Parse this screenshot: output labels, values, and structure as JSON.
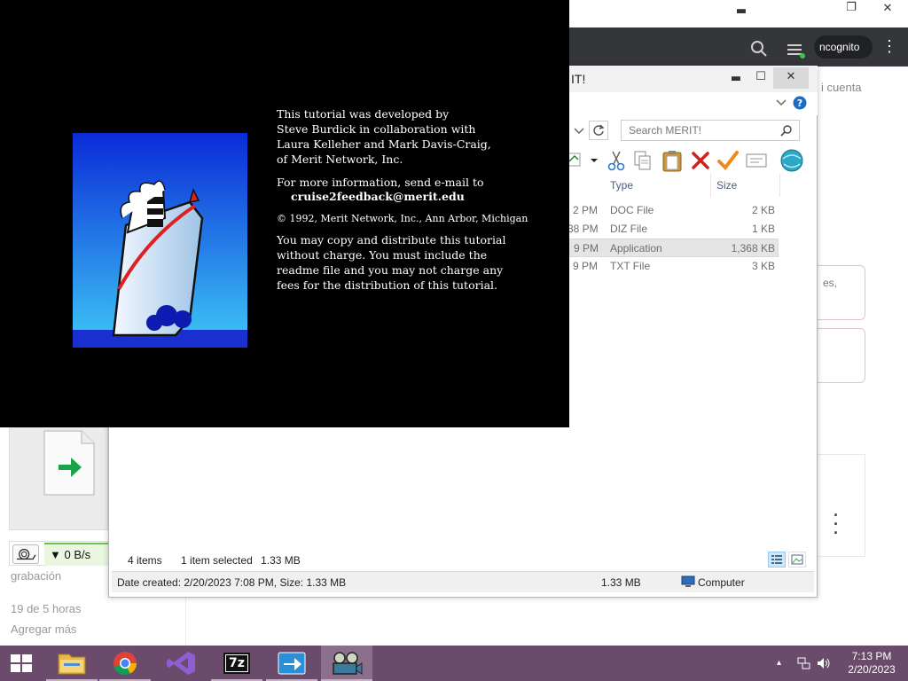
{
  "browser": {
    "incognito_label": "ncognito",
    "kebab": "⋮",
    "window_controls": {
      "minimize": "▬",
      "maximize": "❐",
      "close": "✕"
    },
    "background_texts": {
      "cuenta": "i cuenta",
      "card_text": "es,",
      "grabacion": "grabación",
      "hours": "19 de 5 horas",
      "agregar": "Agregar más"
    },
    "download": {
      "speed": "▼ 0 B/s"
    }
  },
  "explorer": {
    "title": "IT!",
    "window_controls": {
      "minimize": "▬",
      "maximize": "☐",
      "close": "✕"
    },
    "search_placeholder": "Search MERIT!",
    "columns": {
      "type": "Type",
      "size": "Size"
    },
    "files": [
      {
        "time": "2 PM",
        "type": "DOC File",
        "size": "2 KB",
        "selected": false
      },
      {
        "time": "38 PM",
        "type": "DIZ File",
        "size": "1 KB",
        "selected": false
      },
      {
        "time": "9 PM",
        "type": "Application",
        "size": "1,368 KB",
        "selected": true
      },
      {
        "time": "9 PM",
        "type": "TXT File",
        "size": "3 KB",
        "selected": false
      }
    ],
    "status": {
      "items": "4 items",
      "selected": "1 item selected",
      "selected_size": "1.33 MB"
    },
    "details_bar": {
      "created": "Date created: 2/20/2023 7:08 PM, Size: 1.33 MB",
      "size": "1.33 MB",
      "location": "Computer"
    }
  },
  "splash": {
    "credit_lines": [
      "This tutorial was developed by",
      "Steve Burdick in collaboration with",
      "Laura Kelleher and Mark Davis-Craig,",
      "of Merit Network, Inc."
    ],
    "info_line": "For more information, send e-mail to",
    "email": "cruise2feedback@merit.edu",
    "copyright": "© 1992, Merit Network, Inc., Ann Arbor, Michigan",
    "license_lines": [
      "You may copy and distribute this tutorial",
      "without charge. You must include the",
      "readme file and you may not charge any",
      "fees for the distribution of this tutorial."
    ]
  },
  "taskbar": {
    "apps": [
      "start",
      "file-explorer",
      "chrome",
      "visual-studio",
      "7zip",
      "installer",
      "cruise-tutorial"
    ],
    "seven_zip_label": "7z",
    "clock_time": "7:13 PM",
    "clock_date": "2/20/2023",
    "tray_chevron": "▴"
  },
  "colors": {
    "taskbar": "#6a4b6b",
    "splash_bg": "#000000",
    "chrome_toolbar": "#35363a",
    "ship_sky_top": "#0a2bd8",
    "ship_sky_bottom": "#3ec8f5"
  }
}
